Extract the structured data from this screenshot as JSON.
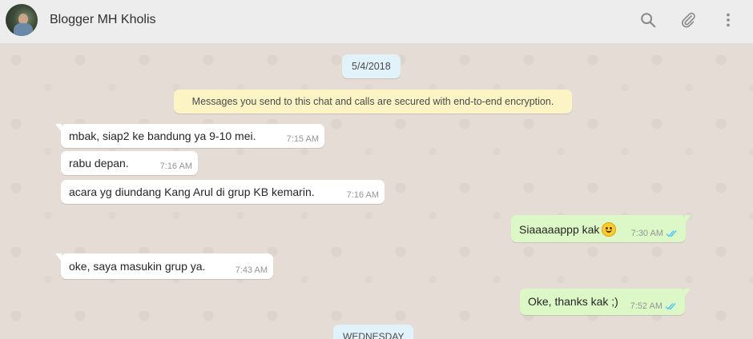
{
  "header": {
    "contact_name": "Blogger MH Kholis",
    "icons": [
      "search-icon",
      "attach-icon",
      "menu-icon"
    ]
  },
  "chat": {
    "date_first": "5/4/2018",
    "system_message": "Messages you send to this chat and calls are secured with end-to-end encryption.",
    "messages": [
      {
        "direction": "in",
        "text": "mbak, siap2 ke bandung ya 9-10 mei.",
        "time": "7:15 AM"
      },
      {
        "direction": "in",
        "text": "rabu depan.",
        "time": "7:16 AM"
      },
      {
        "direction": "in",
        "text": "acara yg diundang Kang Arul di grup KB kemarin.",
        "time": "7:16 AM"
      },
      {
        "direction": "out",
        "text": "Siaaaaappp kak",
        "emoji": "smiling-face",
        "time": "7:30 AM",
        "status": "read"
      },
      {
        "direction": "in",
        "text": "oke, saya masukin grup ya.",
        "time": "7:43 AM"
      },
      {
        "direction": "out",
        "text": "Oke, thanks kak ;)",
        "time": "7:52 AM",
        "status": "read"
      }
    ],
    "date_second": "WEDNESDAY"
  },
  "colors": {
    "chat_background": "#e5ddd5",
    "incoming_bubble": "#ffffff",
    "outgoing_bubble": "#dcf8c6",
    "date_chip": "#e1f2fa",
    "system_message": "#fdf4c5",
    "read_ticks": "#4fc3f7"
  }
}
